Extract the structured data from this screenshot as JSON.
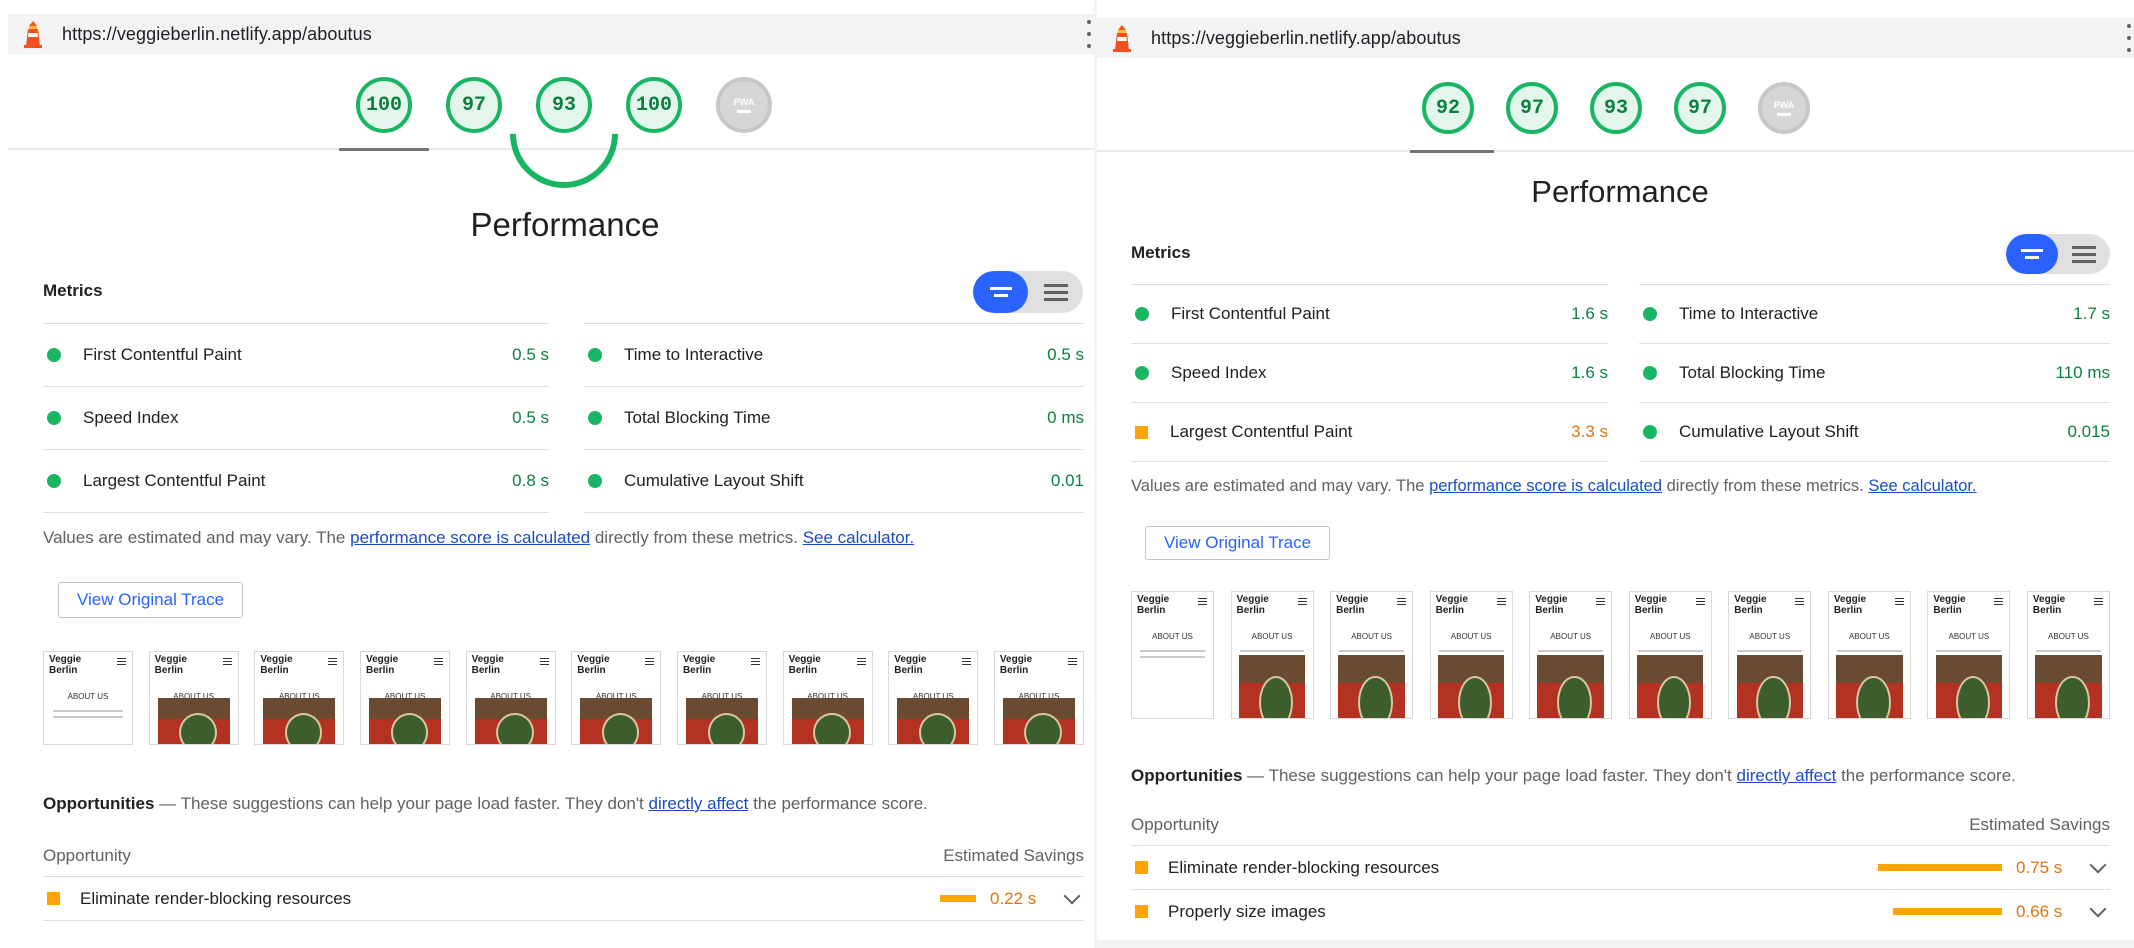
{
  "left": {
    "url": "https://veggieberlin.netlify.app/aboutus",
    "scores": [
      "100",
      "97",
      "93",
      "100"
    ],
    "na_label": "PWA",
    "section_title": "Performance",
    "metrics_heading": "Metrics",
    "metrics_left": [
      {
        "name": "First Contentful Paint",
        "value": "0.5 s",
        "status": "pass"
      },
      {
        "name": "Speed Index",
        "value": "0.5 s",
        "status": "pass"
      },
      {
        "name": "Largest Contentful Paint",
        "value": "0.8 s",
        "status": "pass"
      }
    ],
    "metrics_right": [
      {
        "name": "Time to Interactive",
        "value": "0.5 s",
        "status": "pass"
      },
      {
        "name": "Total Blocking Time",
        "value": "0 ms",
        "status": "pass"
      },
      {
        "name": "Cumulative Layout Shift",
        "value": "0.01",
        "status": "pass"
      }
    ],
    "note": {
      "prefix": "Values are estimated and may vary. The ",
      "link1": "performance score is calculated",
      "middle": " directly from these metrics. ",
      "link2": "See calculator."
    },
    "trace_button": "View Original Trace",
    "frame_title": "Veggie Berlin",
    "frame_heading": "ABOUT US",
    "opportunities": {
      "title": "Opportunities",
      "dash": " — ",
      "desc_prefix": "These suggestions can help your page load faster. They don't ",
      "desc_link": "directly affect",
      "desc_suffix": " the performance score.",
      "col_left": "Opportunity",
      "col_right": "Estimated Savings",
      "rows": [
        {
          "name": "Eliminate render-blocking resources",
          "savings": "0.22 s",
          "fill": 0.29
        }
      ]
    }
  },
  "right": {
    "url": "https://veggieberlin.netlify.app/aboutus",
    "scores": [
      "92",
      "97",
      "93",
      "97"
    ],
    "na_label": "PWA",
    "section_title": "Performance",
    "metrics_heading": "Metrics",
    "metrics_left": [
      {
        "name": "First Contentful Paint",
        "value": "1.6 s",
        "status": "pass"
      },
      {
        "name": "Speed Index",
        "value": "1.6 s",
        "status": "pass"
      },
      {
        "name": "Largest Contentful Paint",
        "value": "3.3 s",
        "status": "average"
      }
    ],
    "metrics_right": [
      {
        "name": "Time to Interactive",
        "value": "1.7 s",
        "status": "pass"
      },
      {
        "name": "Total Blocking Time",
        "value": "110 ms",
        "status": "pass"
      },
      {
        "name": "Cumulative Layout Shift",
        "value": "0.015",
        "status": "pass"
      }
    ],
    "note": {
      "prefix": "Values are estimated and may vary. The ",
      "link1": "performance score is calculated",
      "middle": " directly from these metrics. ",
      "link2": "See calculator."
    },
    "trace_button": "View Original Trace",
    "frame_title": "Veggie Berlin",
    "frame_heading": "ABOUT US",
    "opportunities": {
      "title": "Opportunities",
      "dash": " — ",
      "desc_prefix": "These suggestions can help your page load faster. They don't ",
      "desc_link": "directly affect",
      "desc_suffix": " the performance score.",
      "col_left": "Opportunity",
      "col_right": "Estimated Savings",
      "rows": [
        {
          "name": "Eliminate render-blocking resources",
          "savings": "0.75 s",
          "fill": 1.0
        },
        {
          "name": "Properly size images",
          "savings": "0.66 s",
          "fill": 0.88
        }
      ]
    }
  },
  "colors": {
    "pass": "#18b663",
    "pass_text": "#0c8040",
    "average": "#ffa400",
    "average_text": "#e8710a",
    "link": "#1a4cc8",
    "toggle_active": "#2962ff"
  },
  "icons": [
    "lighthouse-icon",
    "kebab-menu-icon",
    "metrics-toggle-icon",
    "chevron-down-icon",
    "hamburger-icon"
  ]
}
